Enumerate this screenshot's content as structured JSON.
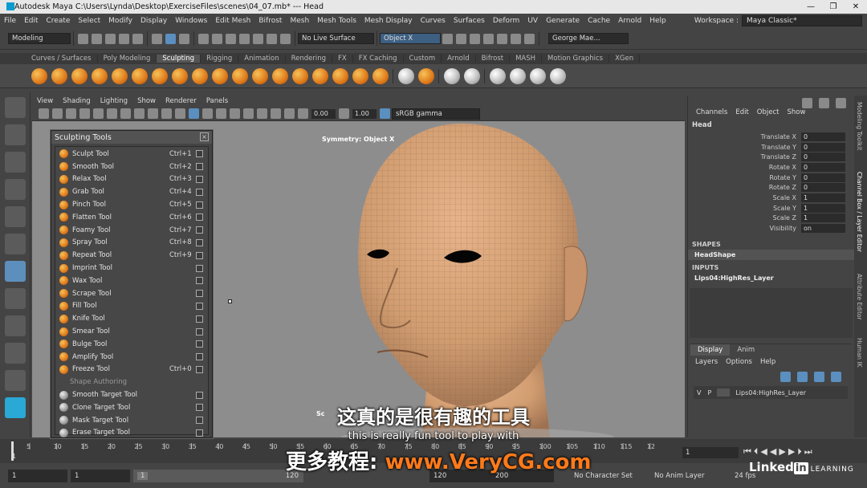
{
  "titlebar": {
    "title": "Autodesk Maya  C:\\Users\\Lynda\\Desktop\\ExerciseFiles\\scenes\\04_07.mb*  ---  Head",
    "minimize": "—",
    "maximize": "❐",
    "close": "✕"
  },
  "menubar": {
    "items": [
      "File",
      "Edit",
      "Create",
      "Select",
      "Modify",
      "Display",
      "Windows",
      "Edit Mesh",
      "Bifrost",
      "Mesh",
      "Mesh Tools",
      "Mesh Display",
      "Curves",
      "Surfaces",
      "Deform",
      "UV",
      "Generate",
      "Cache",
      "Arnold",
      "Help"
    ],
    "workspace_label": "Workspace :",
    "workspace_value": "Maya Classic*"
  },
  "statusline": {
    "mode": "Modeling",
    "live_surface": "No Live Surface",
    "object_field": "Object X",
    "user": "George Mae..."
  },
  "shelf": {
    "tabs": [
      "Curves / Surfaces",
      "Poly Modeling",
      "Sculpting",
      "Rigging",
      "Animation",
      "Rendering",
      "FX",
      "FX Caching",
      "Custom",
      "Arnold",
      "Bifrost",
      "MASH",
      "Motion Graphics",
      "XGen"
    ],
    "active_tab": "Sculpting"
  },
  "viewport": {
    "menu": [
      "View",
      "Shading",
      "Lighting",
      "Show",
      "Renderer",
      "Panels"
    ],
    "exposure": "0.00",
    "gamma": "1.00",
    "color_space": "sRGB gamma",
    "symmetry_label": "Symmetry: Object X",
    "hud_fragment": "Sc"
  },
  "sculpting_tools": {
    "title": "Sculpting Tools",
    "tools": [
      {
        "name": "Sculpt Tool",
        "shortcut": "Ctrl+1"
      },
      {
        "name": "Smooth Tool",
        "shortcut": "Ctrl+2"
      },
      {
        "name": "Relax Tool",
        "shortcut": "Ctrl+3"
      },
      {
        "name": "Grab Tool",
        "shortcut": "Ctrl+4"
      },
      {
        "name": "Pinch Tool",
        "shortcut": "Ctrl+5"
      },
      {
        "name": "Flatten Tool",
        "shortcut": "Ctrl+6"
      },
      {
        "name": "Foamy Tool",
        "shortcut": "Ctrl+7"
      },
      {
        "name": "Spray Tool",
        "shortcut": "Ctrl+8"
      },
      {
        "name": "Repeat Tool",
        "shortcut": "Ctrl+9"
      },
      {
        "name": "Imprint Tool",
        "shortcut": ""
      },
      {
        "name": "Wax Tool",
        "shortcut": ""
      },
      {
        "name": "Scrape Tool",
        "shortcut": ""
      },
      {
        "name": "Fill Tool",
        "shortcut": ""
      },
      {
        "name": "Knife Tool",
        "shortcut": ""
      },
      {
        "name": "Smear Tool",
        "shortcut": ""
      },
      {
        "name": "Bulge Tool",
        "shortcut": ""
      },
      {
        "name": "Amplify Tool",
        "shortcut": ""
      },
      {
        "name": "Freeze Tool",
        "shortcut": "Ctrl+0"
      }
    ],
    "section_label": "Shape Authoring",
    "shape_tools": [
      "Smooth Target Tool",
      "Clone Target Tool",
      "Mask Target Tool",
      "Erase Target Tool"
    ]
  },
  "channel_box": {
    "menu": [
      "Channels",
      "Edit",
      "Object",
      "Show"
    ],
    "object": "Head",
    "attributes": [
      {
        "name": "Translate X",
        "value": "0"
      },
      {
        "name": "Translate Y",
        "value": "0"
      },
      {
        "name": "Translate Z",
        "value": "0"
      },
      {
        "name": "Rotate X",
        "value": "0"
      },
      {
        "name": "Rotate Y",
        "value": "0"
      },
      {
        "name": "Rotate Z",
        "value": "0"
      },
      {
        "name": "Scale X",
        "value": "1"
      },
      {
        "name": "Scale Y",
        "value": "1"
      },
      {
        "name": "Scale Z",
        "value": "1"
      },
      {
        "name": "Visibility",
        "value": "on"
      }
    ],
    "shapes_label": "SHAPES",
    "shape_name": "HeadShape",
    "inputs_label": "INPUTS",
    "input_name": "Lips04:HighRes_Layer"
  },
  "layer_editor": {
    "tabs": [
      "Display",
      "Anim"
    ],
    "active_tab": "Display",
    "menu": [
      "Layers",
      "Options",
      "Help"
    ],
    "layer": {
      "v": "V",
      "p": "P",
      "name": "Lips04:HighRes_Layer"
    }
  },
  "side_tabs": [
    "Modeling Toolkit",
    "Channel Box / Layer Editor",
    "Attribute Editor",
    "Human IK"
  ],
  "timeline": {
    "ticks": [
      "5",
      "10",
      "15",
      "20",
      "25",
      "30",
      "35",
      "40",
      "45",
      "50",
      "55",
      "60",
      "65",
      "70",
      "75",
      "80",
      "85",
      "90",
      "95",
      "100",
      "105",
      "110",
      "115",
      "12"
    ],
    "current_frame": "1",
    "first_tick": "1"
  },
  "range": {
    "start": "1",
    "anim_start": "1",
    "slider_start": "1",
    "slider_end": "120",
    "anim_end": "120",
    "end": "200",
    "character_set": "No Character Set",
    "anim_layer": "No Anim Layer",
    "fps": "24 fps"
  },
  "subtitles": {
    "chinese": "这真的是很有趣的工具",
    "english": "this is really fun tool to play with"
  },
  "watermark": {
    "prefix": "更多教程: ",
    "url": "www.VeryCG.com"
  },
  "brand": {
    "linked": "Linked",
    "in": "in",
    "learning": "LEARNING"
  }
}
